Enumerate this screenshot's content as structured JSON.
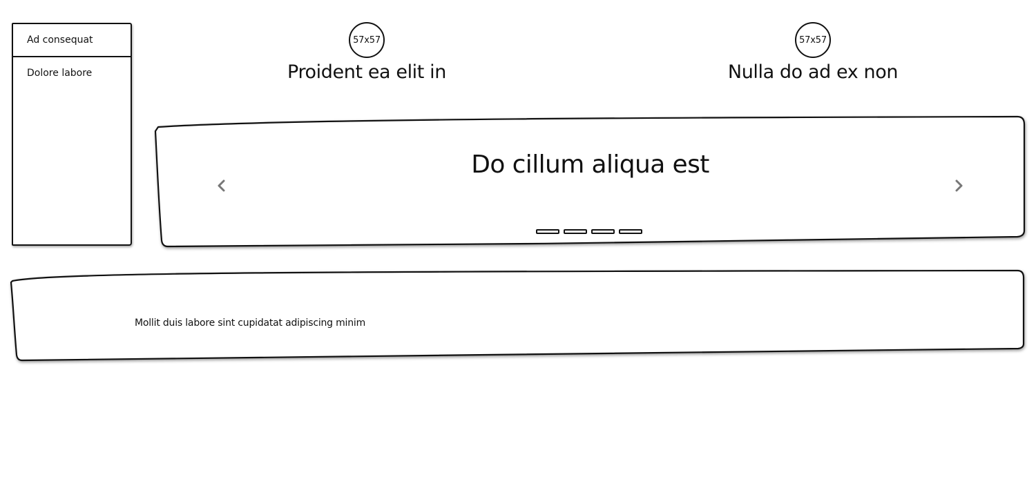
{
  "sidebar": {
    "items": [
      {
        "label": "Ad consequat"
      },
      {
        "label": "Dolore labore"
      }
    ]
  },
  "features": [
    {
      "badge": "57x57",
      "title": "Proident ea elit in"
    },
    {
      "badge": "57x57",
      "title": "Nulla do ad ex non"
    }
  ],
  "carousel": {
    "title": "Do cillum aliqua est",
    "prev_icon": "chevron-left-icon",
    "next_icon": "chevron-right-icon",
    "slide_count": 4,
    "arrow_color": "#777777"
  },
  "panel": {
    "text": "Mollit duis labore sint cupidatat adipiscing minim"
  }
}
